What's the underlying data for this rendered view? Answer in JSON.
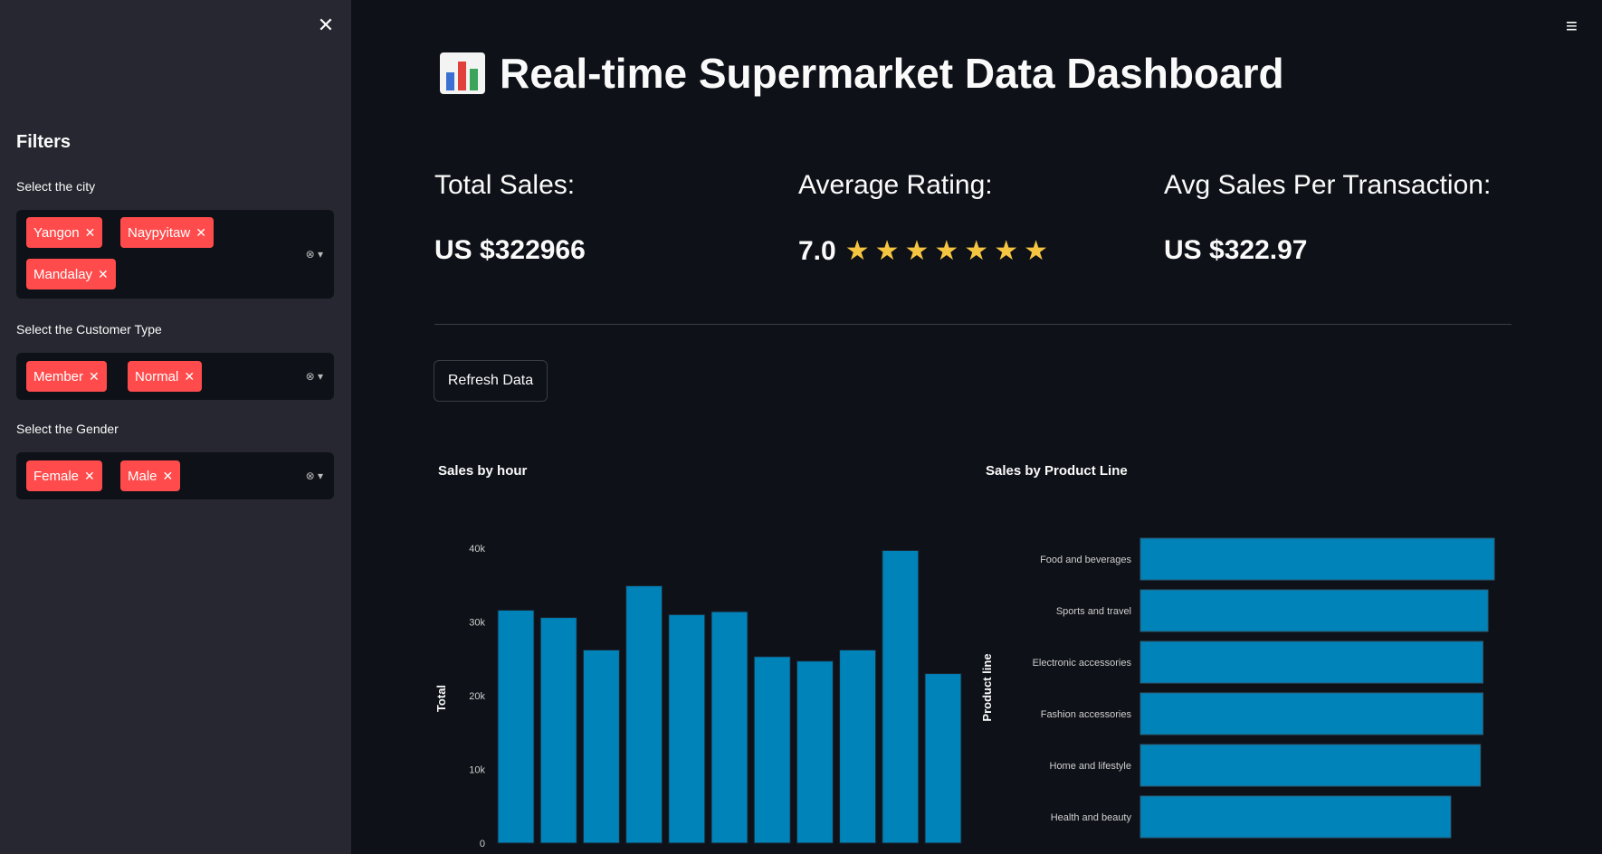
{
  "sidebar": {
    "heading": "Filters",
    "close_icon": "close-icon",
    "filters": [
      {
        "label": "Select the city",
        "tags": [
          "Yangon",
          "Naypyitaw",
          "Mandalay"
        ]
      },
      {
        "label": "Select the Customer Type",
        "tags": [
          "Member",
          "Normal"
        ]
      },
      {
        "label": "Select the Gender",
        "tags": [
          "Female",
          "Male"
        ]
      }
    ]
  },
  "header": {
    "menu_icon": "hamburger-menu-icon"
  },
  "main": {
    "title": "Real-time Supermarket Data Dashboard",
    "metrics": [
      {
        "label": "Total Sales:",
        "value": "US $322966"
      },
      {
        "label": "Average Rating:",
        "value": "7.0",
        "stars": "★★★★★★★"
      },
      {
        "label": "Avg Sales Per Transaction:",
        "value": "US $322.97"
      }
    ],
    "refresh_button": "Refresh Data"
  },
  "chart_data": [
    {
      "type": "bar",
      "title": "Sales by hour",
      "ylabel": "Total",
      "xlabel": "",
      "yticks": [
        "0",
        "10k",
        "20k",
        "30k",
        "40k"
      ],
      "ylim": [
        0,
        40000
      ],
      "values": [
        31600,
        30600,
        26200,
        34900,
        31000,
        31400,
        25300,
        24700,
        26200,
        39700,
        23000
      ],
      "color": "#0083b8"
    },
    {
      "type": "bar",
      "orientation": "horizontal",
      "title": "Sales by Product Line",
      "ylabel": "Product line",
      "categories": [
        "Food and beverages",
        "Sports and travel",
        "Electronic accessories",
        "Fashion accessories",
        "Home and lifestyle",
        "Health and beauty"
      ],
      "values": [
        56100,
        55100,
        54300,
        54300,
        53900,
        49200
      ],
      "xlim": [
        0,
        56100
      ],
      "color": "#0083b8"
    }
  ]
}
